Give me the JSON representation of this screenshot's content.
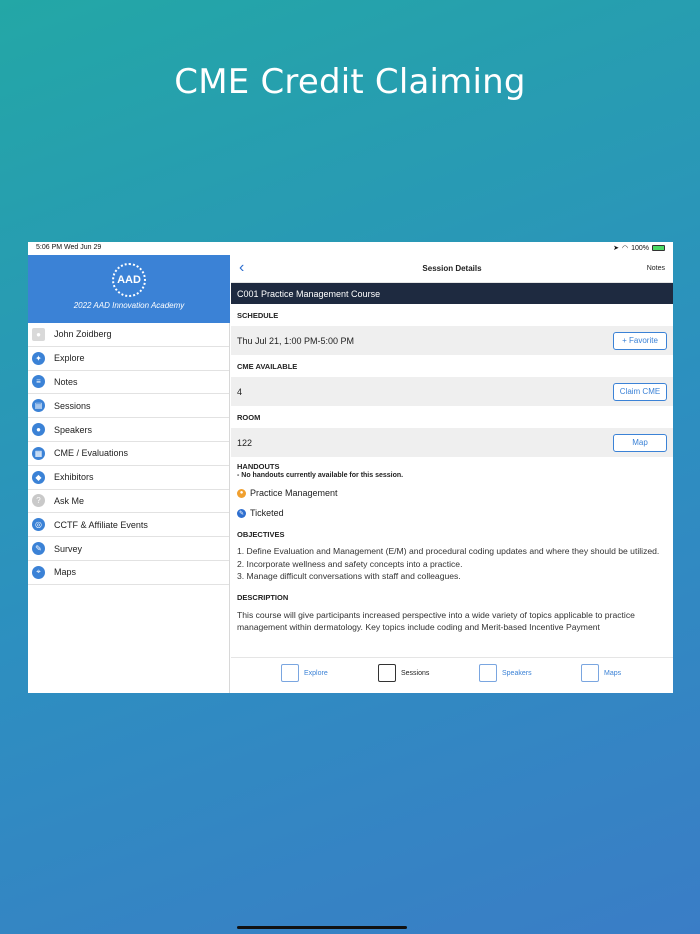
{
  "headline": "CME Credit Claiming",
  "status": {
    "time": "5:06 PM   Wed Jun 29",
    "battery": "100%"
  },
  "sidebar": {
    "logo_text": "AAD",
    "subtitle": "2022 AAD Innovation Academy",
    "items": [
      {
        "label": "John Zoidberg",
        "icon": "person-icon"
      },
      {
        "label": "Explore",
        "icon": "compass-icon"
      },
      {
        "label": "Notes",
        "icon": "notes-icon"
      },
      {
        "label": "Sessions",
        "icon": "sessions-icon"
      },
      {
        "label": "Speakers",
        "icon": "microphone-icon"
      },
      {
        "label": "CME / Evaluations",
        "icon": "clipboard-icon"
      },
      {
        "label": "Exhibitors",
        "icon": "exhibitors-icon"
      },
      {
        "label": "Ask Me",
        "icon": "question-icon"
      },
      {
        "label": "CCTF & Affiliate Events",
        "icon": "events-icon"
      },
      {
        "label": "Survey",
        "icon": "survey-icon"
      },
      {
        "label": "Maps",
        "icon": "map-icon"
      }
    ]
  },
  "nav": {
    "title": "Session Details",
    "notes": "Notes"
  },
  "session": {
    "title": "C001 Practice Management Course",
    "schedule_label": "SCHEDULE",
    "schedule_value": "Thu Jul 21, 1:00 PM-5:00 PM",
    "favorite_button": "+ Favorite",
    "cme_label": "CME AVAILABLE",
    "cme_value": "4",
    "claim_button": "Claim CME",
    "room_label": "ROOM",
    "room_value": "122",
    "map_button": "Map",
    "handouts_label": "HANDOUTS",
    "handouts_note": " - No handouts currently available for this session.",
    "tag1": "Practice Management",
    "tag2": "Ticketed",
    "objectives_label": "OBJECTIVES",
    "objectives": [
      "1. Define Evaluation and Management (E/M) and procedural coding updates and where they should be utilized.",
      "2. Incorporate wellness and safety concepts into a practice.",
      "3. Manage difficult conversations with staff and colleagues."
    ],
    "description_label": "DESCRIPTION",
    "description": "This course will give participants increased perspective into a wide variety of topics applicable to practice management within dermatology. Key topics include coding and Merit-based Incentive Payment"
  },
  "tabs": [
    {
      "label": "Explore"
    },
    {
      "label": "Sessions"
    },
    {
      "label": "Speakers"
    },
    {
      "label": "Maps"
    }
  ],
  "colors": {
    "accent": "#3b82d6",
    "title_bar": "#1e2a40",
    "practice_mgmt_dot": "#f0a030",
    "ticketed_dot": "#2f6fcf"
  }
}
